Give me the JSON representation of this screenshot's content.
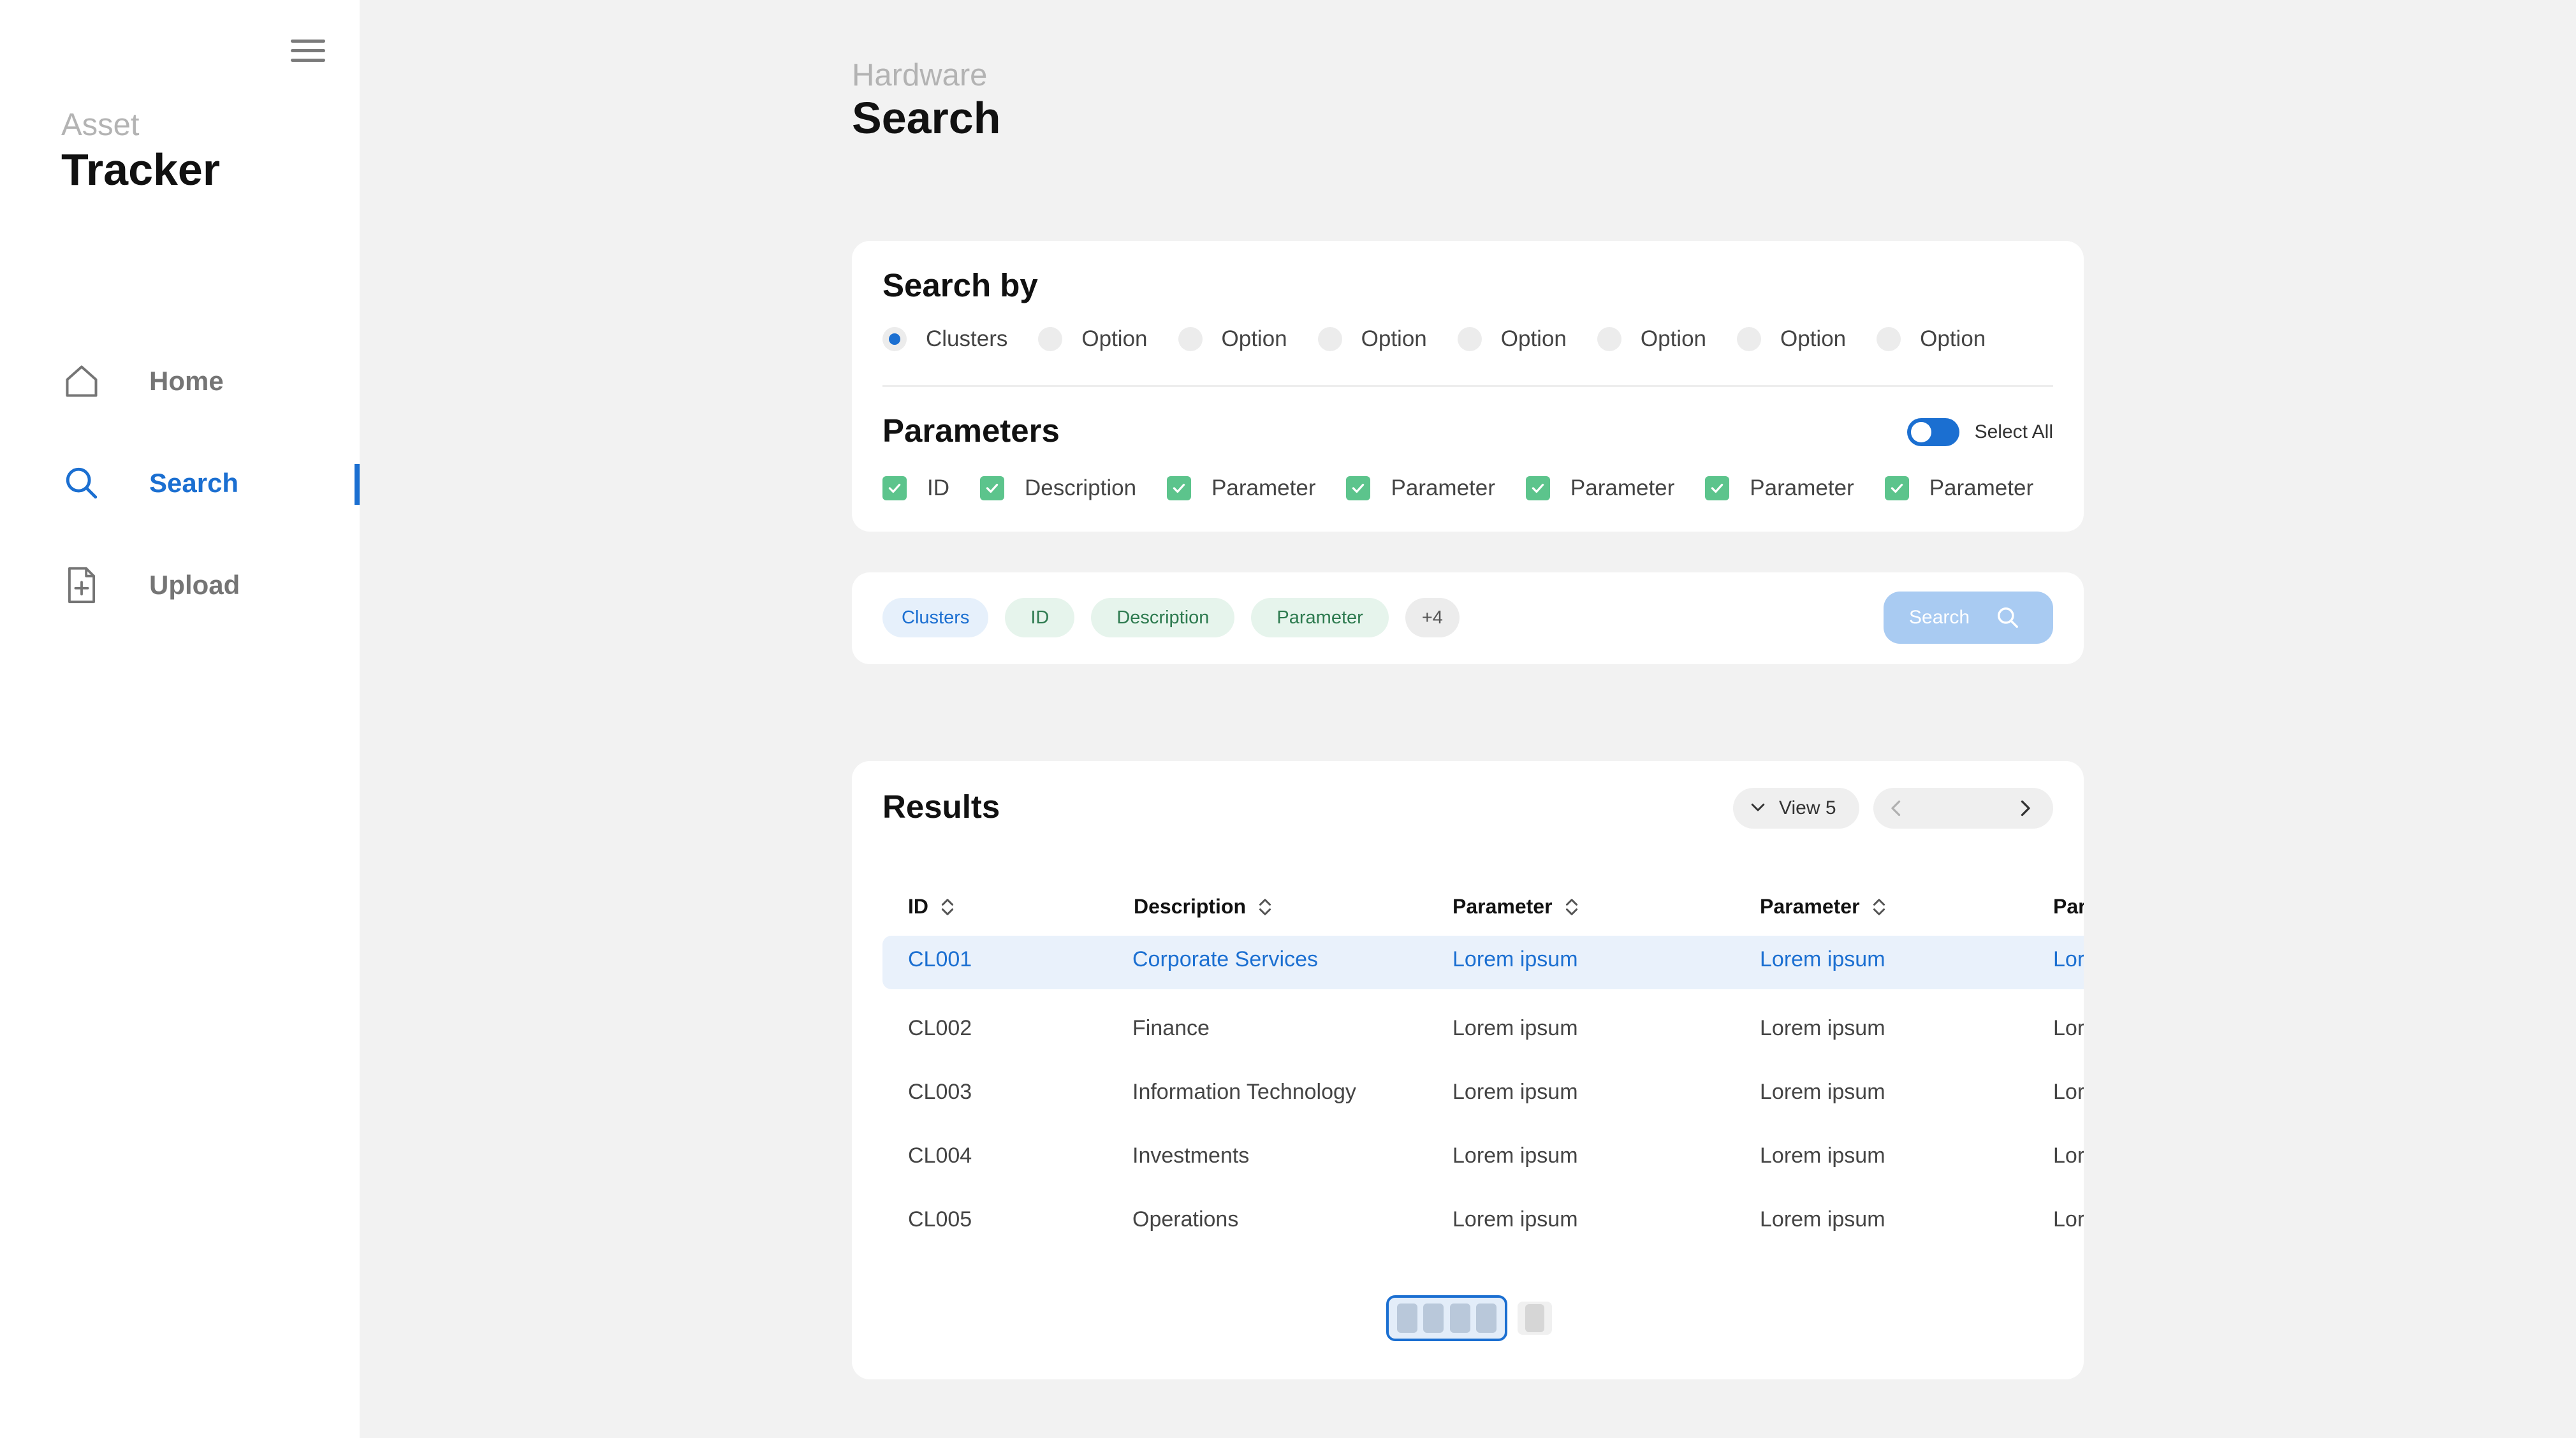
{
  "sidebar": {
    "brand_sub": "Asset",
    "brand_main": "Tracker",
    "items": [
      {
        "label": "Home",
        "icon": "home-icon"
      },
      {
        "label": "Search",
        "icon": "search-icon",
        "active": true
      },
      {
        "label": "Upload",
        "icon": "file-plus-icon"
      }
    ]
  },
  "header": {
    "subtitle": "Hardware",
    "title": "Search"
  },
  "search_by": {
    "title": "Search by",
    "options": [
      "Clusters",
      "Option",
      "Option",
      "Option",
      "Option",
      "Option",
      "Option",
      "Option"
    ],
    "selected": "Clusters"
  },
  "parameters": {
    "title": "Parameters",
    "select_all_label": "Select All",
    "items": [
      "ID",
      "Description",
      "Parameter",
      "Parameter",
      "Parameter",
      "Parameter",
      "Parameter"
    ]
  },
  "filters": {
    "chips": [
      "Clusters",
      "ID",
      "Description",
      "Parameter",
      "+4"
    ],
    "search_label": "Search"
  },
  "results": {
    "title": "Results",
    "view_label": "View 5",
    "columns": [
      "ID",
      "Description",
      "Parameter",
      "Parameter",
      "Parameter"
    ],
    "rows": [
      [
        "CL001",
        "Corporate Services",
        "Lorem ipsum",
        "Lorem ipsum",
        "Lorem ipsum"
      ],
      [
        "CL002",
        "Finance",
        "Lorem ipsum",
        "Lorem ipsum",
        "Lorem ipsum"
      ],
      [
        "CL003",
        "Information Technology",
        "Lorem ipsum",
        "Lorem ipsum",
        "Lorem ipsum"
      ],
      [
        "CL004",
        "Investments",
        "Lorem ipsum",
        "Lorem ipsum",
        "Lorem ipsum"
      ],
      [
        "CL005",
        "Operations",
        "Lorem ipsum",
        "Lorem ipsum",
        "Lorem ipsum"
      ]
    ]
  },
  "colors": {
    "accent": "#1b6fd1",
    "check": "#5cc48c",
    "background": "#f2f2f2"
  }
}
